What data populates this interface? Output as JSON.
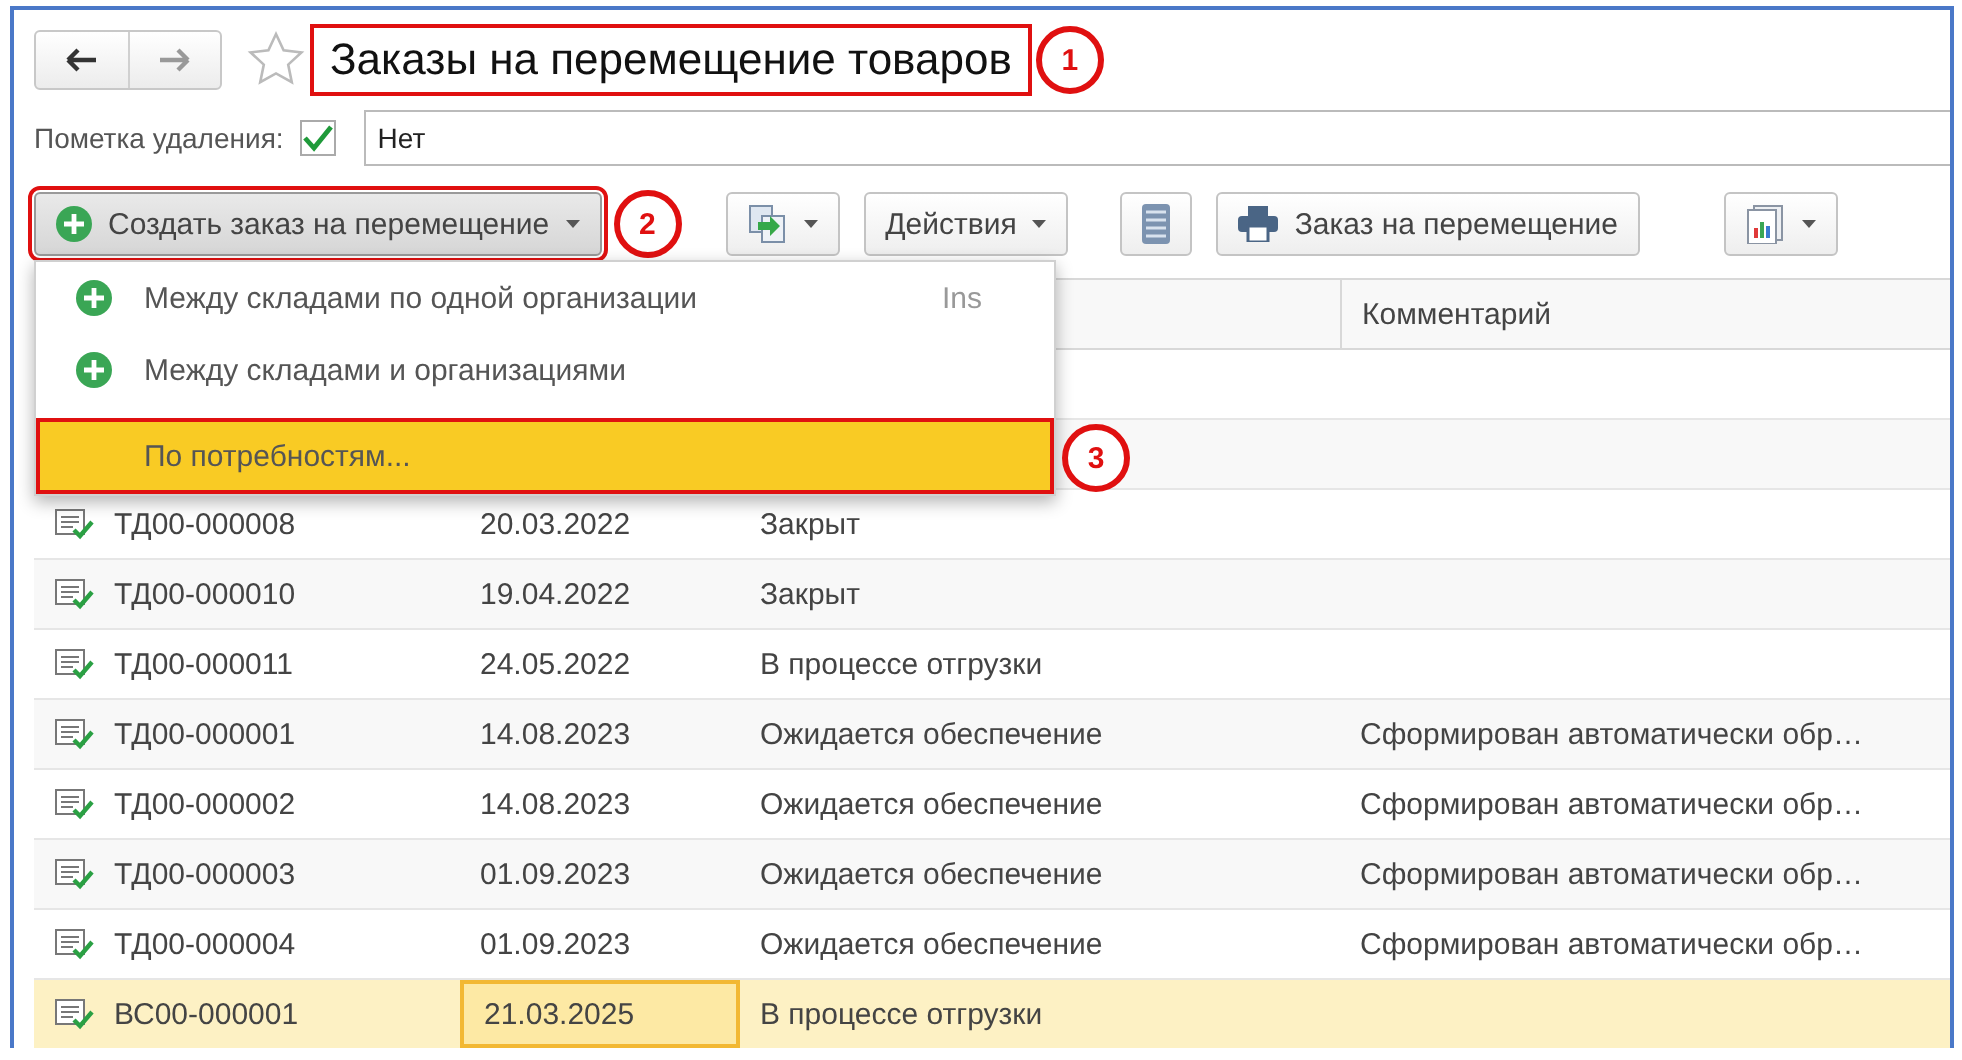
{
  "window": {
    "title": "Заказы на перемещение товаров",
    "highlighted": true,
    "callout": "1"
  },
  "deletion_mark": {
    "label": "Пометка удаления:",
    "checked": true,
    "value": "Нет"
  },
  "toolbar": {
    "buttons": [
      {
        "kind": "create",
        "label": "Создать заказ на перемещение",
        "highlighted": true,
        "callout": "2"
      },
      {
        "kind": "copy"
      },
      {
        "kind": "actions",
        "label": "Действия"
      },
      {
        "kind": "list"
      },
      {
        "kind": "print",
        "label": "Заказ на перемещение"
      },
      {
        "kind": "report"
      }
    ]
  },
  "menu": {
    "items": [
      {
        "kind": "add",
        "label": "Между складами по одной организации",
        "shortcut": "Ins",
        "selected": false
      },
      {
        "kind": "add",
        "label": "Между складами и организациями",
        "selected": false
      },
      {
        "kind": "plain",
        "label": "По потребностям...",
        "selected": true,
        "highlighted": true,
        "callout": "3"
      }
    ]
  },
  "table": {
    "comment_header": "Комментарий",
    "rows": [
      {
        "number": "ТД00-000008",
        "date": "20.03.2022",
        "status": "Закрыт",
        "selected": false
      },
      {
        "number": "ТД00-000010",
        "date": "19.04.2022",
        "status": "Закрыт",
        "selected": false
      },
      {
        "number": "ТД00-000011",
        "date": "24.05.2022",
        "status": "В процессе отгрузки",
        "selected": false
      },
      {
        "number": "ТД00-000001",
        "date": "14.08.2023",
        "status": "Ожидается обеспечение",
        "comment": "Сформирован автоматически обр…",
        "selected": false
      },
      {
        "number": "ТД00-000002",
        "date": "14.08.2023",
        "status": "Ожидается обеспечение",
        "comment": "Сформирован автоматически обр…",
        "selected": false
      },
      {
        "number": "ТД00-000003",
        "date": "01.09.2023",
        "status": "Ожидается обеспечение",
        "comment": "Сформирован автоматически обр…",
        "selected": false
      },
      {
        "number": "ТД00-000004",
        "date": "01.09.2023",
        "status": "Ожидается обеспечение",
        "comment": "Сформирован автоматически обр…",
        "selected": false
      },
      {
        "number": "ВС00-000001",
        "date": "21.03.2025",
        "status": "В процессе отгрузки",
        "selected": true
      }
    ]
  }
}
